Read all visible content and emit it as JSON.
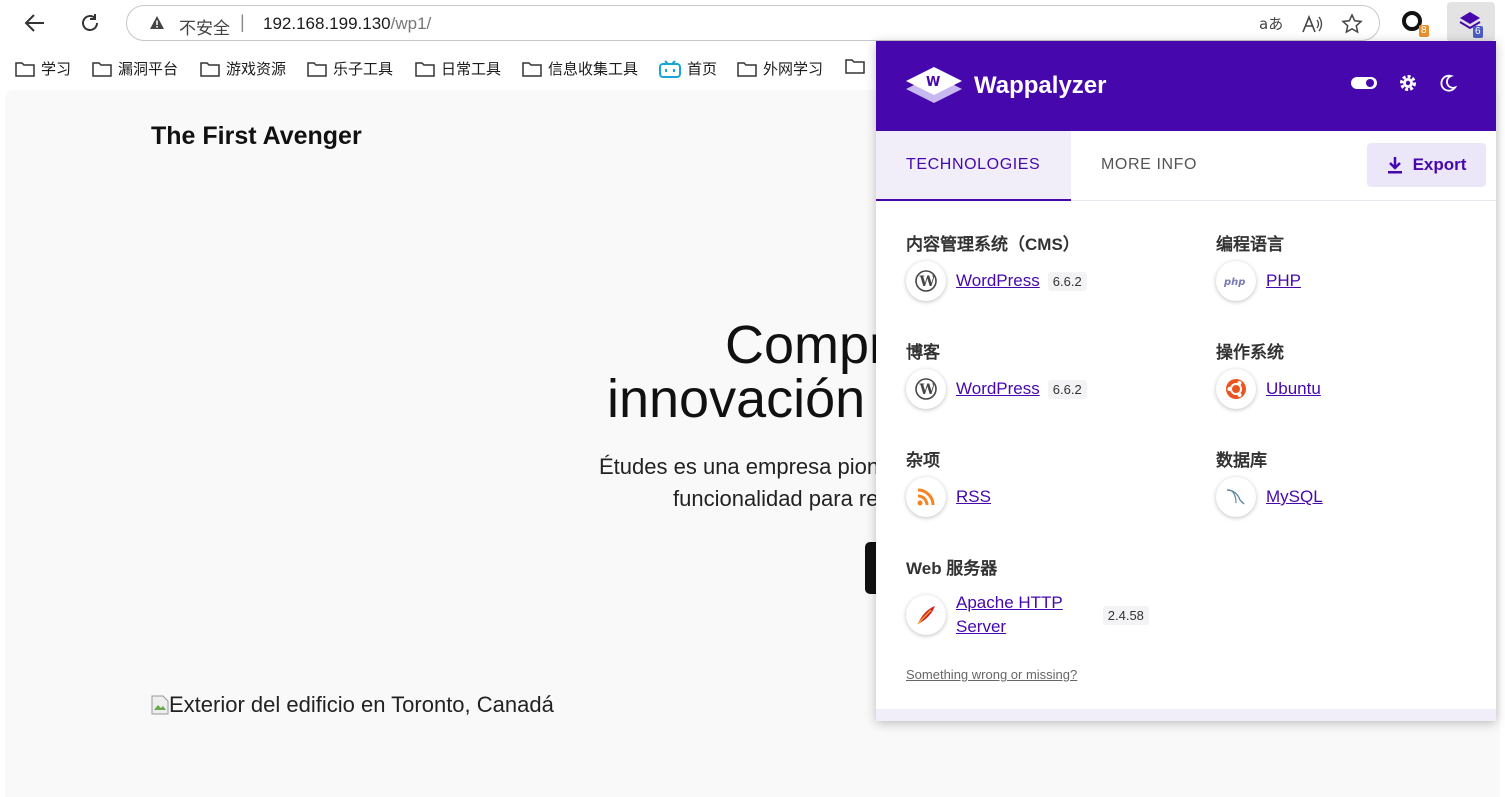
{
  "browser": {
    "security_label": "不安全",
    "separator": "|",
    "url_host": "192.168.199.130",
    "url_path": "/wp1/",
    "ext1_badge": "8",
    "ext2_badge": "6"
  },
  "bookmarks": [
    {
      "label": "学习"
    },
    {
      "label": "漏洞平台"
    },
    {
      "label": "游戏资源"
    },
    {
      "label": "乐子工具"
    },
    {
      "label": "日常工具"
    },
    {
      "label": "信息收集工具"
    },
    {
      "label": "首页"
    },
    {
      "label": "外网学习"
    }
  ],
  "page": {
    "site_title": "The First Avenger",
    "hero_line1": "Compr",
    "hero_line2": "innovación",
    "hero_desc1": "Études es una empresa pion",
    "hero_desc2": "funcionalidad para re",
    "image_alt": "Exterior del edificio en Toronto, Canadá"
  },
  "wappalyzer": {
    "brand": "Wappalyzer",
    "tabs": {
      "technologies": "TECHNOLOGIES",
      "more_info": "MORE INFO"
    },
    "export_label": "Export",
    "categories": {
      "cms": {
        "title": "内容管理系统（CMS）",
        "tech": {
          "name": "WordPress",
          "version": "6.6.2"
        }
      },
      "blog": {
        "title": "博客",
        "tech": {
          "name": "WordPress",
          "version": "6.6.2"
        }
      },
      "misc": {
        "title": "杂项",
        "tech": {
          "name": "RSS"
        }
      },
      "webserver": {
        "title": "Web 服务器",
        "tech": {
          "name_line1": "Apache HTTP",
          "name_line2": "Server",
          "version": "2.4.58"
        }
      },
      "lang": {
        "title": "编程语言",
        "tech": {
          "name": "PHP"
        }
      },
      "os": {
        "title": "操作系统",
        "tech": {
          "name": "Ubuntu"
        }
      },
      "db": {
        "title": "数据库",
        "tech": {
          "name": "MySQL"
        }
      }
    },
    "footer_link": "Something wrong or missing?",
    "colors": {
      "brand": "#4608ad",
      "tab_bg": "#f1eefa"
    }
  }
}
